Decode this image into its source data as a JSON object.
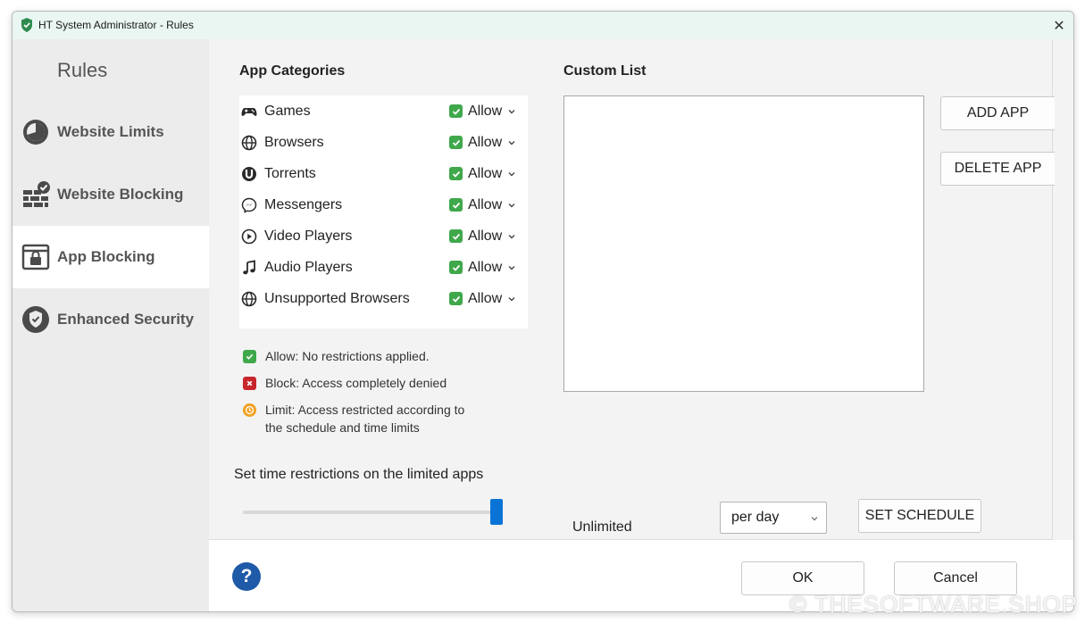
{
  "window": {
    "title": "HT System Administrator - Rules",
    "close_glyph": "✕"
  },
  "sidebar": {
    "title": "Rules",
    "items": [
      {
        "label": "Website Limits",
        "icon": "clock-icon",
        "active": false
      },
      {
        "label": "Website Blocking",
        "icon": "firewall-icon",
        "active": false
      },
      {
        "label": "App Blocking",
        "icon": "lock-window-icon",
        "active": true
      },
      {
        "label": "Enhanced Security",
        "icon": "shield-check-icon",
        "active": false
      }
    ]
  },
  "categories": {
    "heading": "App Categories",
    "items": [
      {
        "name": "Games",
        "icon": "gamepad-icon",
        "status": "Allow"
      },
      {
        "name": "Browsers",
        "icon": "globe-icon",
        "status": "Allow"
      },
      {
        "name": "Torrents",
        "icon": "torrent-icon",
        "status": "Allow"
      },
      {
        "name": "Messengers",
        "icon": "messenger-icon",
        "status": "Allow"
      },
      {
        "name": "Video Players",
        "icon": "play-icon",
        "status": "Allow"
      },
      {
        "name": "Audio Players",
        "icon": "music-note-icon",
        "status": "Allow"
      },
      {
        "name": "Unsupported Browsers",
        "icon": "globe-icon",
        "status": "Allow"
      }
    ]
  },
  "legend": {
    "allow": "Allow: No restrictions applied.",
    "block": "Block: Access completely denied",
    "limit_line1": "Limit: Access restricted according to",
    "limit_line2": "the schedule and time limits"
  },
  "custom_list": {
    "heading": "Custom List",
    "add_button": "ADD APP",
    "delete_button": "DELETE APP"
  },
  "time": {
    "heading": "Set time restrictions on the limited apps",
    "slider_value_label": "Unlimited",
    "slider_fraction": 1.0,
    "period_selected": "per day",
    "schedule_button": "SET SCHEDULE"
  },
  "footer": {
    "help_glyph": "?",
    "ok_button": "OK",
    "cancel_button": "Cancel"
  },
  "watermark": "© THESOFTWARE.SHOP",
  "colors": {
    "allow_green": "#3fa84b",
    "block_red": "#c8252c",
    "limit_orange": "#f0a020",
    "accent_blue": "#0a74d6",
    "help_blue": "#1f5aa8"
  }
}
